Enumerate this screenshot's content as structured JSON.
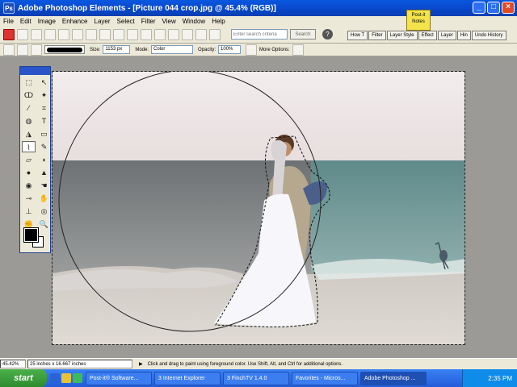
{
  "window": {
    "title": "Adobe Photoshop Elements - [Picture 044 crop.jpg @ 45.4% (RGB)]"
  },
  "menu": [
    "File",
    "Edit",
    "Image",
    "Enhance",
    "Layer",
    "Select",
    "Filter",
    "View",
    "Window",
    "Help"
  ],
  "toolbar": {
    "search_placeholder": "Enter search criteria",
    "search_label": "Search",
    "help_icon": "?"
  },
  "postit": {
    "top": "Post-it",
    "bottom": "Notes"
  },
  "palette_well": [
    "How T",
    "Filter",
    "Layer Style",
    "Effect",
    "Layer",
    "Hin",
    "Undo History"
  ],
  "options": {
    "size_label": "Size:",
    "size_value": "1153 px",
    "mode_label": "Mode:",
    "mode_value": "Color",
    "opacity_label": "Opacity:",
    "opacity_value": "100%",
    "more_options_label": "More Options:"
  },
  "status": {
    "zoom": "45.42%",
    "dimensions": "25 inches x 16.667 inches",
    "hint": "Click and drag to paint using foreground color. Use Shift, Alt, and Ctrl for additional options."
  },
  "taskbar": {
    "start_label": "start",
    "tasks": [
      "Post-it® Software...",
      "3 Internet Explorer",
      "3 FinchTV 1.4.0",
      "Favorites - Micros...",
      "Adobe Photoshop ..."
    ],
    "clock": "2:35 PM"
  },
  "icons": {
    "tools": [
      "marquee-icon",
      "move-icon",
      "lasso-icon",
      "magic-wand-icon",
      "eyedropper-icon",
      "crop-icon",
      "selection-brush-icon",
      "type-icon",
      "paint-bucket-icon",
      "gradient-icon",
      "brush-icon",
      "pencil-icon",
      "eraser-icon",
      "shape-icon",
      "blur-icon",
      "sharpen-icon",
      "sponge-icon",
      "smudge-icon",
      "dodge-icon",
      "burn-icon",
      "clone-stamp-icon",
      "red-eye-icon",
      "hand-icon",
      "zoom-icon"
    ]
  },
  "colors": {
    "foreground": "#000000",
    "background": "#ffffff"
  }
}
